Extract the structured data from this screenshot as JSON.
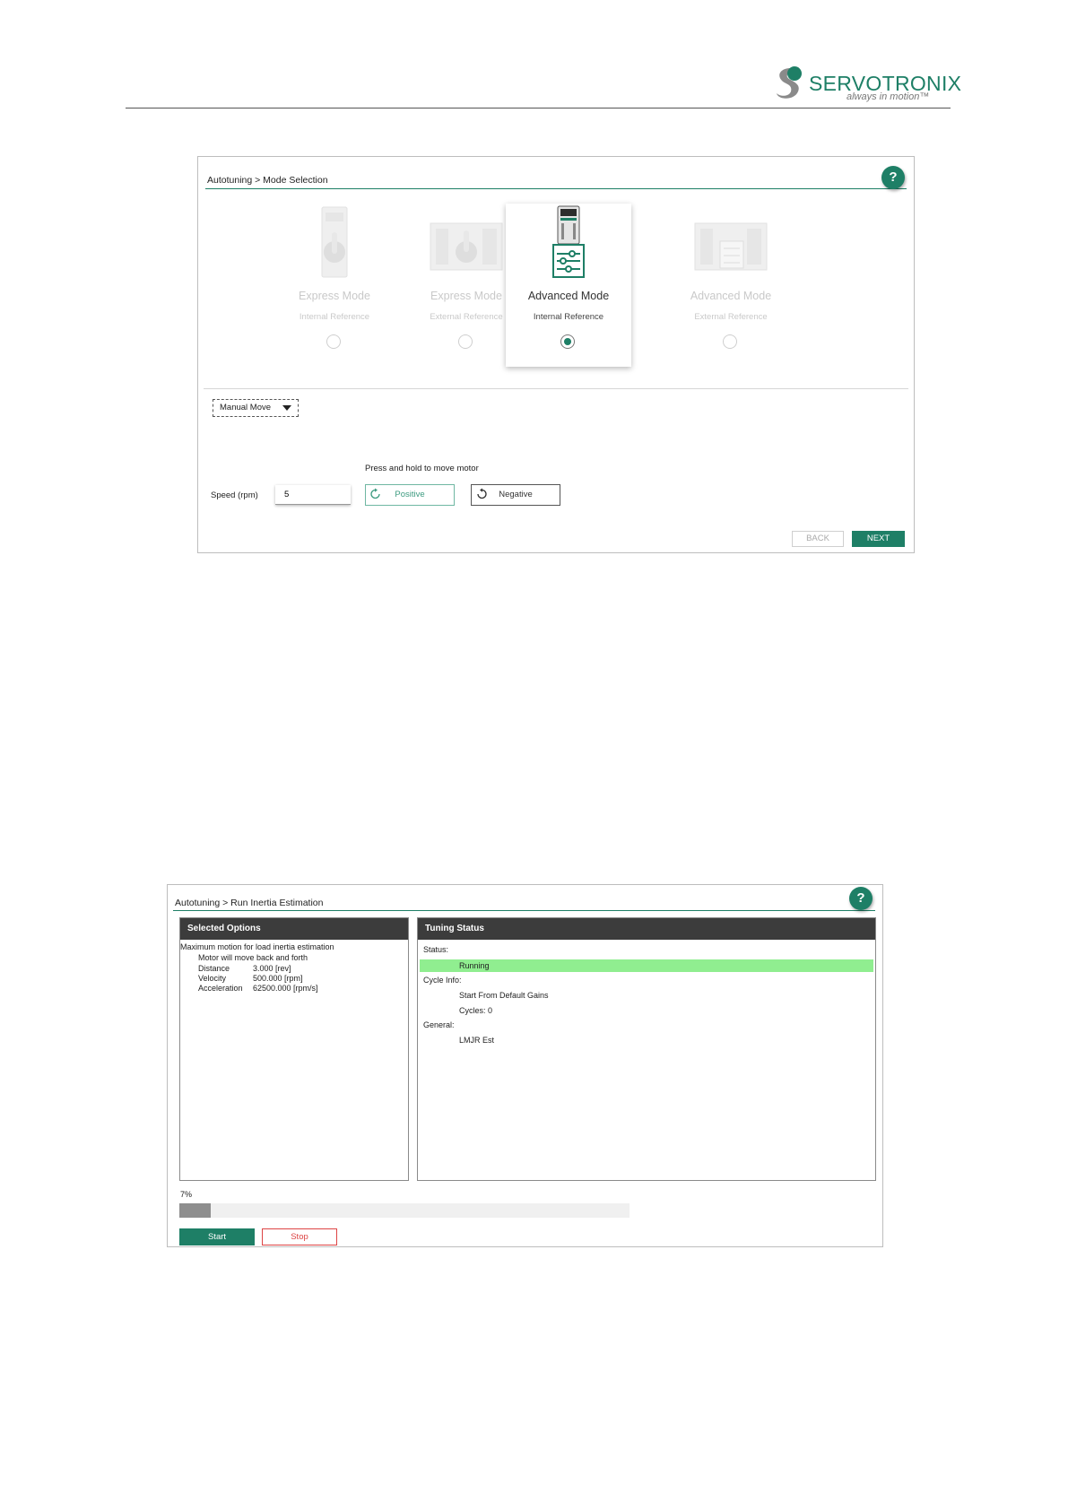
{
  "header": {
    "brand_name": "SERVOTRONIX",
    "brand_tagline": "always in motion™"
  },
  "mode_selection": {
    "breadcrumb": "Autotuning > Mode Selection",
    "help_label": "?",
    "modes": [
      {
        "title": "Express Mode",
        "subtitle": "Internal Reference",
        "selected": false
      },
      {
        "title": "Express Mode",
        "subtitle": "External Reference",
        "selected": false
      },
      {
        "title": "Advanced Mode",
        "subtitle": "Internal Reference",
        "selected": true
      },
      {
        "title": "Advanced Mode",
        "subtitle": "External Reference",
        "selected": false
      }
    ],
    "move_dropdown": "Manual Move",
    "hold_hint": "Press and hold to move motor",
    "speed_label": "Speed (rpm)",
    "speed_value": "5",
    "positive_label": "Positive",
    "negative_label": "Negative",
    "back_label": "BACK",
    "next_label": "NEXT",
    "colors": {
      "accent": "#1e7f66"
    }
  },
  "inertia": {
    "breadcrumb": "Autotuning > Run Inertia Estimation",
    "help_label": "?",
    "selected_options": {
      "title": "Selected Options",
      "line1": "Maximum motion for load inertia estimation",
      "line2": "Motor will move back and forth",
      "rows": [
        {
          "label": "Distance",
          "value": "3.000 [rev]"
        },
        {
          "label": "Velocity",
          "value": "500.000 [rpm]"
        },
        {
          "label": "Acceleration",
          "value": "62500.000 [rpm/s]"
        }
      ]
    },
    "tuning_status": {
      "title": "Tuning Status",
      "status_label": "Status:",
      "status_value": "Running",
      "cycle_label": "Cycle Info:",
      "cycle_line1": "Start From Default Gains",
      "cycle_line2": "Cycles: 0",
      "general_label": "General:",
      "general_value": "LMJR Est"
    },
    "progress_text": "7%",
    "progress_fraction": 0.07,
    "start_label": "Start",
    "stop_label": "Stop",
    "colors": {
      "running": "#90ee90",
      "stop": "#dd4444"
    }
  }
}
